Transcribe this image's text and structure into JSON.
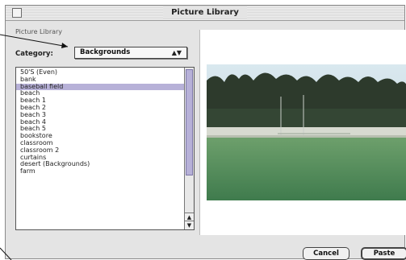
{
  "window": {
    "title": "Picture Library"
  },
  "library": {
    "group_label": "Picture Library",
    "category_label": "Category:",
    "category_value": "Backgrounds",
    "items": [
      "50'S (Even)",
      "bank",
      "baseball field",
      "beach",
      "beach 1",
      "beach 2",
      "beach 3",
      "beach 4",
      "beach 5",
      "bookstore",
      "classroom",
      "classroom 2",
      "curtains",
      "desert (Backgrounds)",
      "farm"
    ],
    "selected_index": 2
  },
  "buttons": {
    "cancel": "Cancel",
    "paste": "Paste"
  },
  "colors": {
    "selection": "#b7b1d8",
    "window_bg": "#e4e4e4",
    "grass": "#4f8a58",
    "trees": "#2d3a2c"
  }
}
